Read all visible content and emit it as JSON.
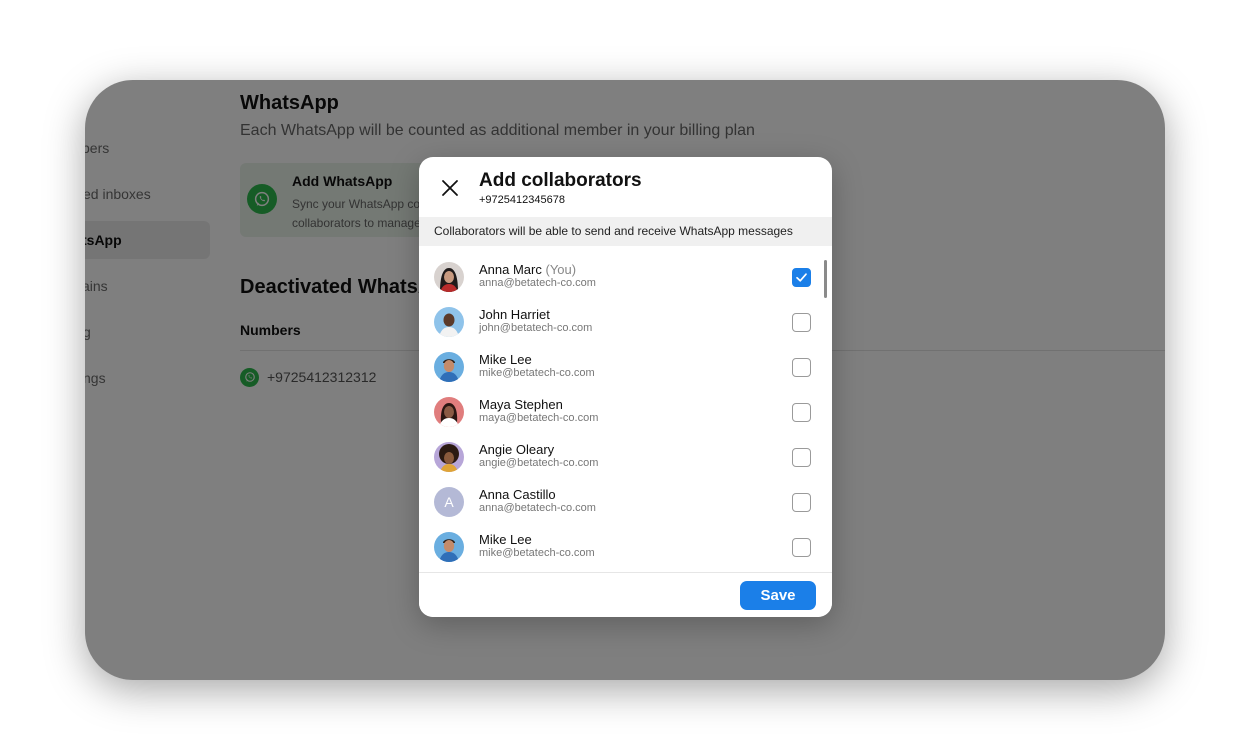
{
  "sidebar": {
    "items": [
      {
        "label": "bers",
        "active": false
      },
      {
        "label": "ed inboxes",
        "active": false
      },
      {
        "label": "tsApp",
        "active": true
      },
      {
        "label": "ains",
        "active": false
      },
      {
        "label": "g",
        "active": false
      },
      {
        "label": "ngs",
        "active": false
      }
    ]
  },
  "main": {
    "title": "WhatsApp",
    "subtitle": "Each WhatsApp will be counted as additional member in your billing plan",
    "add_card": {
      "title": "Add WhatsApp",
      "line1": "Sync your WhatsApp cor",
      "line2": "collaborators to manage"
    },
    "deactivated_title": "Deactivated WhatsA",
    "numbers_header": "Numbers",
    "numbers": [
      "+9725412312312"
    ]
  },
  "modal": {
    "title": "Add collaborators",
    "phone": "+9725412345678",
    "info": "Collaborators will be able to send and receive WhatsApp messages",
    "save_label": "Save",
    "collaborators": [
      {
        "name": "Anna Marc",
        "suffix": "(You)",
        "email": "anna@betatech-co.com",
        "checked": true,
        "avatar": "woman-dark-hair-photo"
      },
      {
        "name": "John Harriet",
        "suffix": "",
        "email": "john@betatech-co.com",
        "checked": false,
        "avatar": "man-bald-photo"
      },
      {
        "name": "Mike Lee",
        "suffix": "",
        "email": "mike@betatech-co.com",
        "checked": false,
        "avatar": "man-glasses-photo"
      },
      {
        "name": "Maya Stephen",
        "suffix": "",
        "email": "maya@betatech-co.com",
        "checked": false,
        "avatar": "woman-red-photo"
      },
      {
        "name": "Angie Oleary",
        "suffix": "",
        "email": "angie@betatech-co.com",
        "checked": false,
        "avatar": "woman-curly-hair-photo"
      },
      {
        "name": "Anna Castillo",
        "suffix": "",
        "email": "anna@betatech-co.com",
        "checked": false,
        "avatar": "letter",
        "initial": "A"
      },
      {
        "name": "Mike Lee",
        "suffix": "",
        "email": "mike@betatech-co.com",
        "checked": false,
        "avatar": "man-glasses-photo"
      }
    ]
  },
  "colors": {
    "accent": "#1b7fe8",
    "whatsapp_green": "#2db94d",
    "overlay": "#000000"
  }
}
